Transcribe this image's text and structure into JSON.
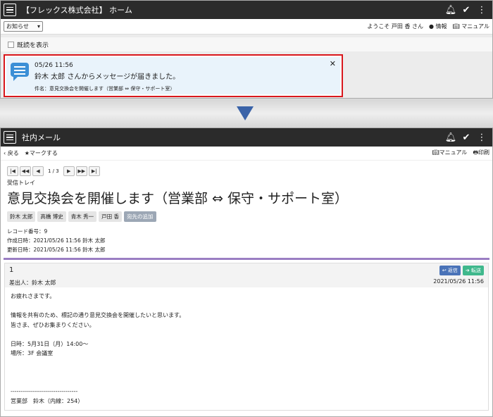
{
  "home": {
    "title": "【フレックス株式会社】 ホーム",
    "filter_select": "お知らせ",
    "user_greeting": "ようこそ 戸田 香 さん",
    "info_link": "情報",
    "manual_link": "マニュアル",
    "show_read_label": "既読を表示",
    "notification": {
      "time": "05/26 11:56",
      "message": "鈴木 太郎 さんからメッセージが届きました。",
      "subject_line": "件名：意見交換会を開催します（営業部 ⇔ 保守・サポート室）"
    }
  },
  "mail": {
    "title": "社内メール",
    "back_label": "戻る",
    "mark_label": "マークする",
    "manual_label": "マニュアル",
    "print_label": "印刷",
    "pager_count": "1 / 3",
    "folder": "受信トレイ",
    "subject": "意見交換会を開催します（営業部 ⇔ 保守・サポート室）",
    "recipients": [
      "鈴木 太郎",
      "高橋 博史",
      "青木 秀一",
      "戸田 香"
    ],
    "add_recipient_label": "宛先の追加",
    "record_number": "レコード番号：9",
    "created": "作成日時：2021/05/26 11:56 鈴木 太郎",
    "updated": "更新日時：2021/05/26 11:56 鈴木 太郎",
    "message": {
      "number": "1",
      "sender": "差出人：鈴木 太郎",
      "date": "2021/05/26 11:56",
      "reply_label": "返信",
      "forward_label": "転送",
      "body": "お疲れさまです。\n\n情報を共有のため、標記の通り意見交換会を開催したいと思います。\n皆さま、ぜひお集まりください。\n\n日時：5月31日（月）14:00～\n場所：3F 会議室\n\n\n\n---------------------------------\n営業部　鈴木（内線：254）"
    }
  },
  "colors": {
    "appbar": "#2b2b2b",
    "highlight": "#d9171c",
    "arrow": "#3a63a8",
    "separator": "#9b7ec3"
  }
}
